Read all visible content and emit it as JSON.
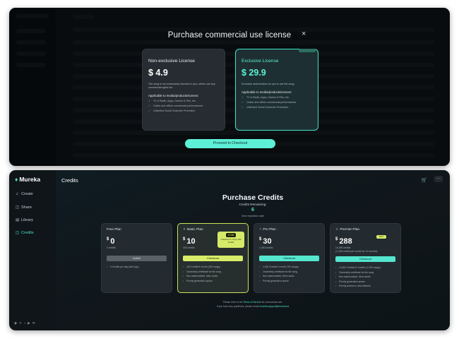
{
  "modal": {
    "title": "Purchase commercial use license",
    "close": "×",
    "proceed": "Proceed to Checkout",
    "licenses": [
      {
        "name": "Non-exclusive License",
        "price": "$ 4.9",
        "description": "The song is non-exclusively licensed to you; others can buy commercial rights too.",
        "applicable_title": "Applicable to media/products/scenes:",
        "features": [
          "TV & Radio, Apps, Games & Film, etc.",
          "Online and offline commercial performances",
          "Unlimited Social Channels Promotion"
        ]
      },
      {
        "name": "Exclusive License",
        "price": "$ 29.9",
        "description": "Exclusive authorization for you to use the song.",
        "applicable_title": "Applicable to media/products/scenes:",
        "features": [
          "TV & Radio, Apps, Games & Film, etc.",
          "Online and offline commercial performances",
          "Unlimited Social Channels Promotion"
        ]
      }
    ]
  },
  "app": {
    "logo": "Mureka",
    "page_title": "Credits",
    "nav": [
      {
        "label": "Create",
        "icon": "music-note-icon"
      },
      {
        "label": "Share",
        "icon": "share-icon"
      },
      {
        "label": "Library",
        "icon": "library-icon"
      },
      {
        "label": "Credits",
        "icon": "credits-icon",
        "active": true
      }
    ]
  },
  "credits": {
    "title": "Purchase Credits",
    "remaining_label": "Credits Remaining:",
    "remaining_value": "6",
    "expiration": "View expiration date",
    "plans": [
      {
        "name": "Free Plan",
        "price": "0",
        "credits": "0 credits",
        "button": "Active",
        "features": [
          "6 Credits per day (lost logo)"
        ]
      },
      {
        "name": "Basic Plan",
        "price": "10",
        "credits": "400 credits",
        "button": "Checkout",
        "tag_time": "12:56",
        "tag_text": "Checkout to enjoy 100 credits",
        "features": [
          "400 Credits/1 month (200 songs)",
          "Ownership certificate for the song",
          "Non-watermarked, stem audio",
          "Priority generation queue"
        ]
      },
      {
        "name": "Pro Plan",
        "price": "30",
        "credits": "1,400 credits",
        "button": "Checkout",
        "features": [
          "1,400 Credits/1 month (700 songs)",
          "Ownership certificate for the song",
          "Non-watermarked, Stem audio",
          "Priority generation queue"
        ]
      },
      {
        "name": "Premier Plan",
        "price": "288",
        "credits": "14,000 credits",
        "credits_note": "(1,166 credits per month for 12 months)",
        "hot": "HOT",
        "button": "Checkout",
        "features": [
          "14,000 Credits/12 months (7,000 songs)",
          "Ownership certificate for the song",
          "Non-watermarked, Stem audio",
          "Priority generation queue",
          "Priority access to new features"
        ]
      }
    ],
    "footer_1_pre": "Please refer to the",
    "footer_1_link": "Terms of Service",
    "footer_1_post": "for commercial use.",
    "footer_2_pre": "If you have any questions, please email",
    "footer_2_link": "mureka.support@mureka.ai"
  }
}
